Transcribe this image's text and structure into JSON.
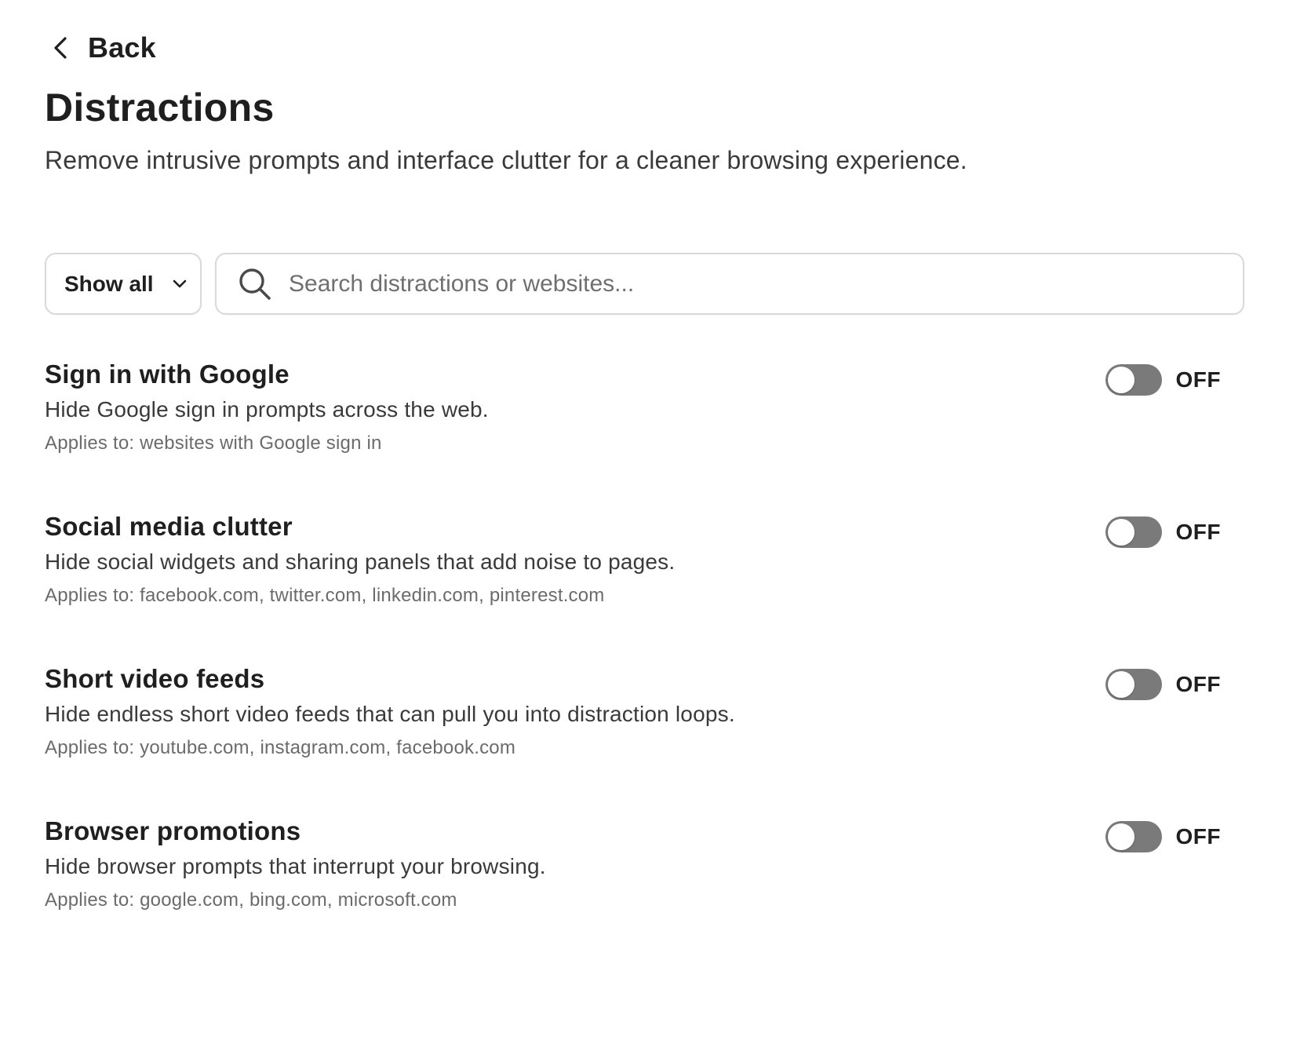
{
  "header": {
    "back_label": "Back",
    "title": "Distractions",
    "subtitle": "Remove intrusive prompts and interface clutter for a cleaner browsing experience."
  },
  "toolbar": {
    "filter_label": "Show all",
    "search_placeholder": "Search distractions or websites...",
    "search_value": ""
  },
  "icons": {
    "back": "chevron-left-icon",
    "filter": "chevron-down-icon",
    "search": "search-icon"
  },
  "colors": {
    "toggle_off_track": "#7a7a7a",
    "toggle_knob": "#ffffff",
    "border": "#d9d9d9"
  },
  "items": [
    {
      "title": "Sign in with Google",
      "description": "Hide Google sign in prompts across the web.",
      "applies_to": "Applies to: websites with Google sign in",
      "state": "OFF"
    },
    {
      "title": "Social media clutter",
      "description": "Hide social widgets and sharing panels that add noise to pages.",
      "applies_to": "Applies to: facebook.com, twitter.com, linkedin.com, pinterest.com",
      "state": "OFF"
    },
    {
      "title": "Short video feeds",
      "description": "Hide endless short video feeds that can pull you into distraction loops.",
      "applies_to": "Applies to: youtube.com, instagram.com, facebook.com",
      "state": "OFF"
    },
    {
      "title": "Browser promotions",
      "description": "Hide browser prompts that interrupt your browsing.",
      "applies_to": "Applies to: google.com, bing.com, microsoft.com",
      "state": "OFF"
    }
  ]
}
